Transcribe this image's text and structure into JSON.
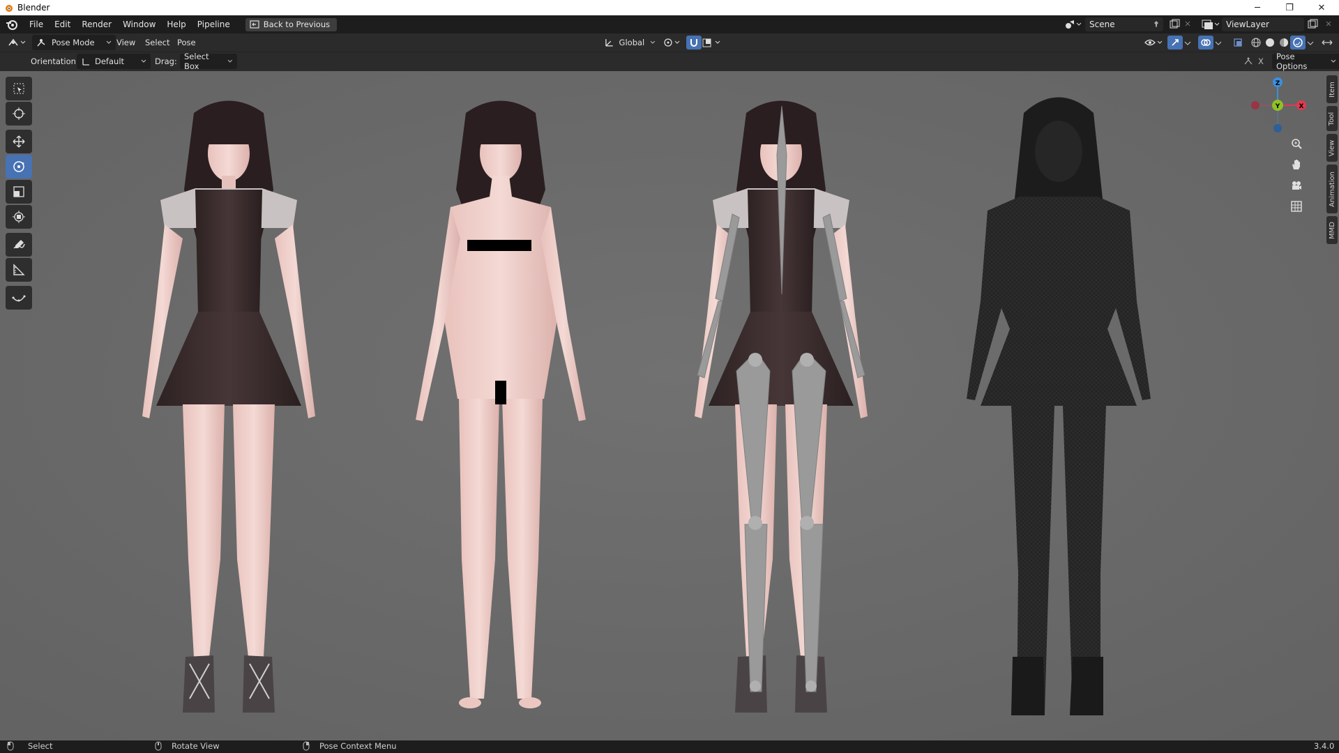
{
  "window": {
    "title": "Blender",
    "minimize": "─",
    "maximize": "❐",
    "close": "✕"
  },
  "menu": {
    "items": [
      "File",
      "Edit",
      "Render",
      "Window",
      "Help",
      "Pipeline"
    ],
    "back_label": "Back to Previous"
  },
  "scene": {
    "name": "Scene",
    "view_layer": "ViewLayer"
  },
  "header": {
    "mode": "Pose Mode",
    "menus": [
      "View",
      "Select",
      "Pose"
    ],
    "transform_orientation": "Global"
  },
  "tool_settings": {
    "orientation_label": "Orientation:",
    "orientation_value": "Default",
    "drag_label": "Drag:",
    "drag_value": "Select Box",
    "pose_options": "Pose Options",
    "close_x": "X"
  },
  "gizmo": {
    "z": "Z",
    "y": "Y",
    "x": "X"
  },
  "sidebar_tabs": [
    "Item",
    "Tool",
    "View",
    "Animation",
    "MMD"
  ],
  "status": {
    "left": "Select",
    "middle": "Rotate View",
    "right": "Pose Context Menu",
    "version": "3.4.0"
  },
  "colors": {
    "accent": "#4772b3",
    "axis_x": "#e03a50",
    "axis_y": "#8fc124",
    "axis_z": "#3b8fde"
  }
}
